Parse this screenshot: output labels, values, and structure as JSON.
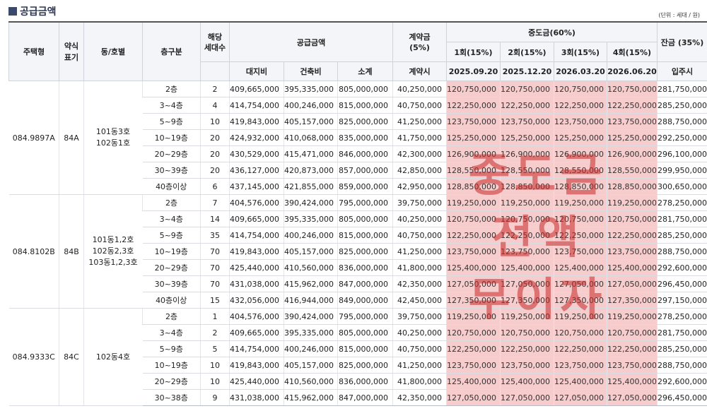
{
  "header": {
    "title": "공급금액",
    "unit_note": "(단위 : 세대 / 원)"
  },
  "table_headers": {
    "type": "주택형",
    "abbr": "약식\n표기",
    "dong_ho": "동/호별",
    "floor": "층구분",
    "households": "해당\n세대수",
    "supply": "공급금액",
    "contract": "계약금\n(5%)",
    "mid": "중도금(60%)",
    "balance": "잔금 (35%)",
    "land": "대지비",
    "building": "건축비",
    "subtotal": "소계",
    "contract_when": "계약시",
    "round1": "1회(15%)",
    "round2": "2회(15%)",
    "round3": "3회(15%)",
    "round4": "4회(15%)",
    "date1": "2025.09.20",
    "date2": "2025.12.20",
    "date3": "2026.03.20",
    "date4": "2026.06.20",
    "balance_when": "입주시"
  },
  "watermark": "중도금\n전액\n무이자",
  "groups": [
    {
      "type": "084.9897A",
      "abbr": "84A",
      "dong_ho": "101동3호\n102동1호",
      "rows": [
        [
          "2층",
          "2",
          "409,665,000",
          "395,335,000",
          "805,000,000",
          "40,250,000",
          "120,750,000",
          "120,750,000",
          "120,750,000",
          "120,750,000",
          "281,750,000"
        ],
        [
          "3~4층",
          "4",
          "414,754,000",
          "400,246,000",
          "815,000,000",
          "40,750,000",
          "122,250,000",
          "122,250,000",
          "122,250,000",
          "122,250,000",
          "285,250,000"
        ],
        [
          "5~9층",
          "10",
          "419,843,000",
          "405,157,000",
          "825,000,000",
          "41,250,000",
          "123,750,000",
          "123,750,000",
          "123,750,000",
          "123,750,000",
          "288,750,000"
        ],
        [
          "10~19층",
          "20",
          "424,932,000",
          "410,068,000",
          "835,000,000",
          "41,750,000",
          "125,250,000",
          "125,250,000",
          "125,250,000",
          "125,250,000",
          "292,250,000"
        ],
        [
          "20~29층",
          "20",
          "430,529,000",
          "415,471,000",
          "846,000,000",
          "42,300,000",
          "126,900,000",
          "126,900,000",
          "126,900,000",
          "126,900,000",
          "296,100,000"
        ],
        [
          "30~39층",
          "20",
          "436,127,000",
          "420,873,000",
          "857,000,000",
          "42,850,000",
          "128,550,000",
          "128,550,000",
          "128,550,000",
          "128,550,000",
          "299,950,000"
        ],
        [
          "40층이상",
          "6",
          "437,145,000",
          "421,855,000",
          "859,000,000",
          "42,950,000",
          "128,850,000",
          "128,850,000",
          "128,850,000",
          "128,850,000",
          "300,650,000"
        ]
      ]
    },
    {
      "type": "084.8102B",
      "abbr": "84B",
      "dong_ho": "101동1,2호\n102동2,3호\n103동1,2,3호",
      "rows": [
        [
          "2층",
          "7",
          "404,576,000",
          "390,424,000",
          "795,000,000",
          "39,750,000",
          "119,250,000",
          "119,250,000",
          "119,250,000",
          "119,250,000",
          "278,250,000"
        ],
        [
          "3~4층",
          "14",
          "409,665,000",
          "395,335,000",
          "805,000,000",
          "40,250,000",
          "120,750,000",
          "120,750,000",
          "120,750,000",
          "120,750,000",
          "281,750,000"
        ],
        [
          "5~9층",
          "35",
          "414,754,000",
          "400,246,000",
          "815,000,000",
          "40,750,000",
          "122,250,000",
          "122,250,000",
          "122,250,000",
          "122,250,000",
          "285,250,000"
        ],
        [
          "10~19층",
          "70",
          "419,843,000",
          "405,157,000",
          "825,000,000",
          "41,250,000",
          "123,750,000",
          "123,750,000",
          "123,750,000",
          "123,750,000",
          "288,750,000"
        ],
        [
          "20~29층",
          "70",
          "425,440,000",
          "410,560,000",
          "836,000,000",
          "41,800,000",
          "125,400,000",
          "125,400,000",
          "125,400,000",
          "125,400,000",
          "292,600,000"
        ],
        [
          "30~39층",
          "70",
          "431,038,000",
          "415,962,000",
          "847,000,000",
          "42,350,000",
          "127,050,000",
          "127,050,000",
          "127,050,000",
          "127,050,000",
          "296,450,000"
        ],
        [
          "40층이상",
          "15",
          "432,056,000",
          "416,944,000",
          "849,000,000",
          "42,450,000",
          "127,350,000",
          "127,350,000",
          "127,350,000",
          "127,350,000",
          "297,150,000"
        ]
      ]
    },
    {
      "type": "084.9333C",
      "abbr": "84C",
      "dong_ho": "102동4호",
      "rows": [
        [
          "2층",
          "1",
          "404,576,000",
          "390,424,000",
          "795,000,000",
          "39,750,000",
          "119,250,000",
          "119,250,000",
          "119,250,000",
          "119,250,000",
          "278,250,000"
        ],
        [
          "3~4층",
          "2",
          "409,665,000",
          "395,335,000",
          "805,000,000",
          "40,250,000",
          "120,750,000",
          "120,750,000",
          "120,750,000",
          "120,750,000",
          "281,750,000"
        ],
        [
          "5~9층",
          "5",
          "414,754,000",
          "400,246,000",
          "815,000,000",
          "40,750,000",
          "122,250,000",
          "122,250,000",
          "122,250,000",
          "122,250,000",
          "285,250,000"
        ],
        [
          "10~19층",
          "10",
          "419,843,000",
          "405,157,000",
          "825,000,000",
          "41,250,000",
          "123,750,000",
          "123,750,000",
          "123,750,000",
          "123,750,000",
          "288,750,000"
        ],
        [
          "20~29층",
          "10",
          "425,440,000",
          "410,560,000",
          "836,000,000",
          "41,800,000",
          "125,400,000",
          "125,400,000",
          "125,400,000",
          "125,400,000",
          "292,600,000"
        ],
        [
          "30~38층",
          "9",
          "431,038,000",
          "415,962,000",
          "847,000,000",
          "42,350,000",
          "127,050,000",
          "127,050,000",
          "127,050,000",
          "127,050,000",
          "296,450,000"
        ]
      ]
    }
  ]
}
